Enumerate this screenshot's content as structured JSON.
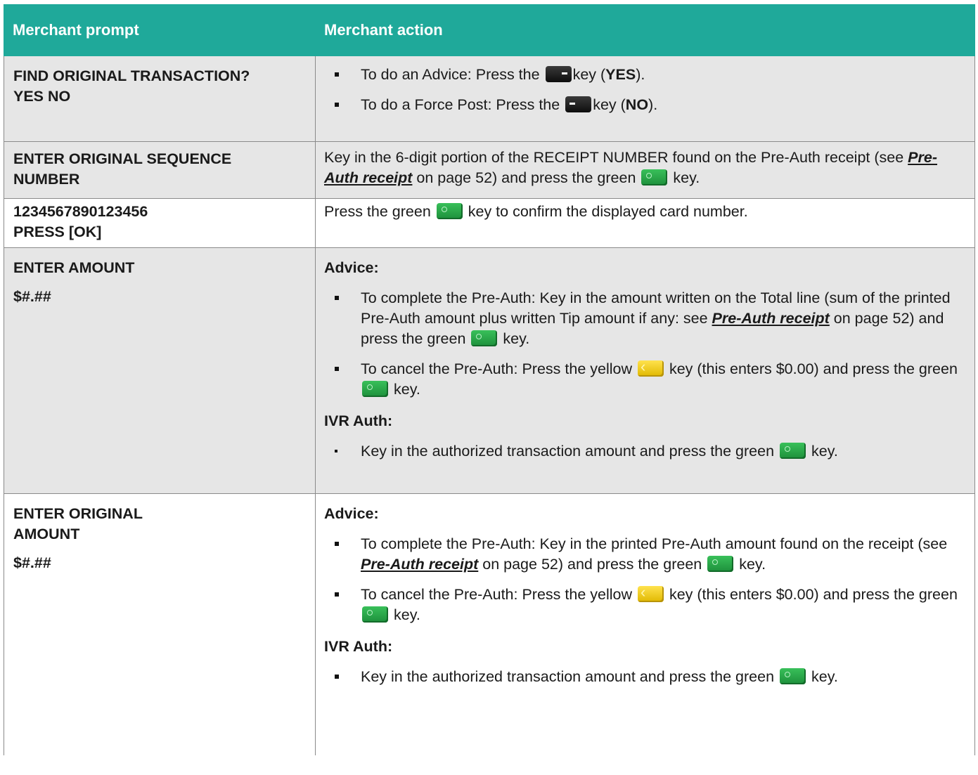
{
  "headers": {
    "prompt": "Merchant prompt",
    "action": "Merchant action"
  },
  "rows": [
    {
      "prompt_line1": "FIND ORIGINAL TRANSACTION?",
      "prompt_yes": "YES",
      "prompt_no": "NO",
      "b1_pre": "To do an Advice: Press the",
      "b1_mid": "key (",
      "b1_bold": "YES",
      "b1_post": ").",
      "b2_pre": "To do a Force Post: Press the",
      "b2_mid": "key (",
      "b2_bold": "NO",
      "b2_post": ")."
    },
    {
      "prompt_line1": "ENTER ORIGINAL SEQUENCE",
      "prompt_line2": "NUMBER",
      "text_pre": "Key in the 6-digit portion of the RECEIPT NUMBER found on the Pre-Auth receipt (see",
      "link": "Pre-Auth receipt",
      "text_post": "on page 52) and press the green",
      "text_end": "key."
    },
    {
      "prompt_line1": "1234567890123456",
      "prompt_line2": "PRESS [OK]",
      "text_pre": "Press the green",
      "text_post": "key to confirm the displayed card number."
    },
    {
      "prompt_line1": "ENTER AMOUNT",
      "prompt_line2": "$#.##",
      "advice_label": "Advice",
      "advice_colon": ":",
      "a1_pre": "To complete the Pre-Auth: Key in the amount written on the Total line (sum of the printed Pre-Auth amount plus written Tip amount if any: see",
      "a1_link": "Pre-Auth receipt",
      "a1_post": "on page 52) and press the green",
      "a1_end": "key.",
      "a2_pre": "To cancel the Pre-Auth: Press the yellow",
      "a2_mid": "key (this enters $0.00) and press the green",
      "a2_end": "key.",
      "ivr_label": "IVR Auth:",
      "i1_pre": "Key in the authorized transaction amount and press the green",
      "i1_end": "key."
    },
    {
      "prompt_line1": "ENTER ORIGINAL",
      "prompt_line2": "AMOUNT",
      "prompt_line3": "$#.##",
      "advice_label": "Advice:",
      "a1_pre": "To complete the Pre-Auth: Key in the printed Pre-Auth amount found on the receipt (see",
      "a1_link": "Pre-Auth receipt",
      "a1_post": "on page 52) and press the green",
      "a1_end": "key.",
      "a2_pre": "To cancel the Pre-Auth: Press the yellow",
      "a2_mid": "key (this enters $0.00) and press the green",
      "a2_end": "key.",
      "ivr_label": "IVR Auth:",
      "i1_pre": "Key in the authorized transaction amount and press the green",
      "i1_end": "key."
    }
  ],
  "colors": {
    "header_bg": "#1fa99a",
    "shade_bg": "#e6e6e6"
  },
  "icons": {
    "green_key": "green-ok-key-icon",
    "yellow_key": "yellow-clear-key-icon",
    "left_soft_key": "left-softkey-icon",
    "right_soft_key": "right-softkey-icon"
  }
}
